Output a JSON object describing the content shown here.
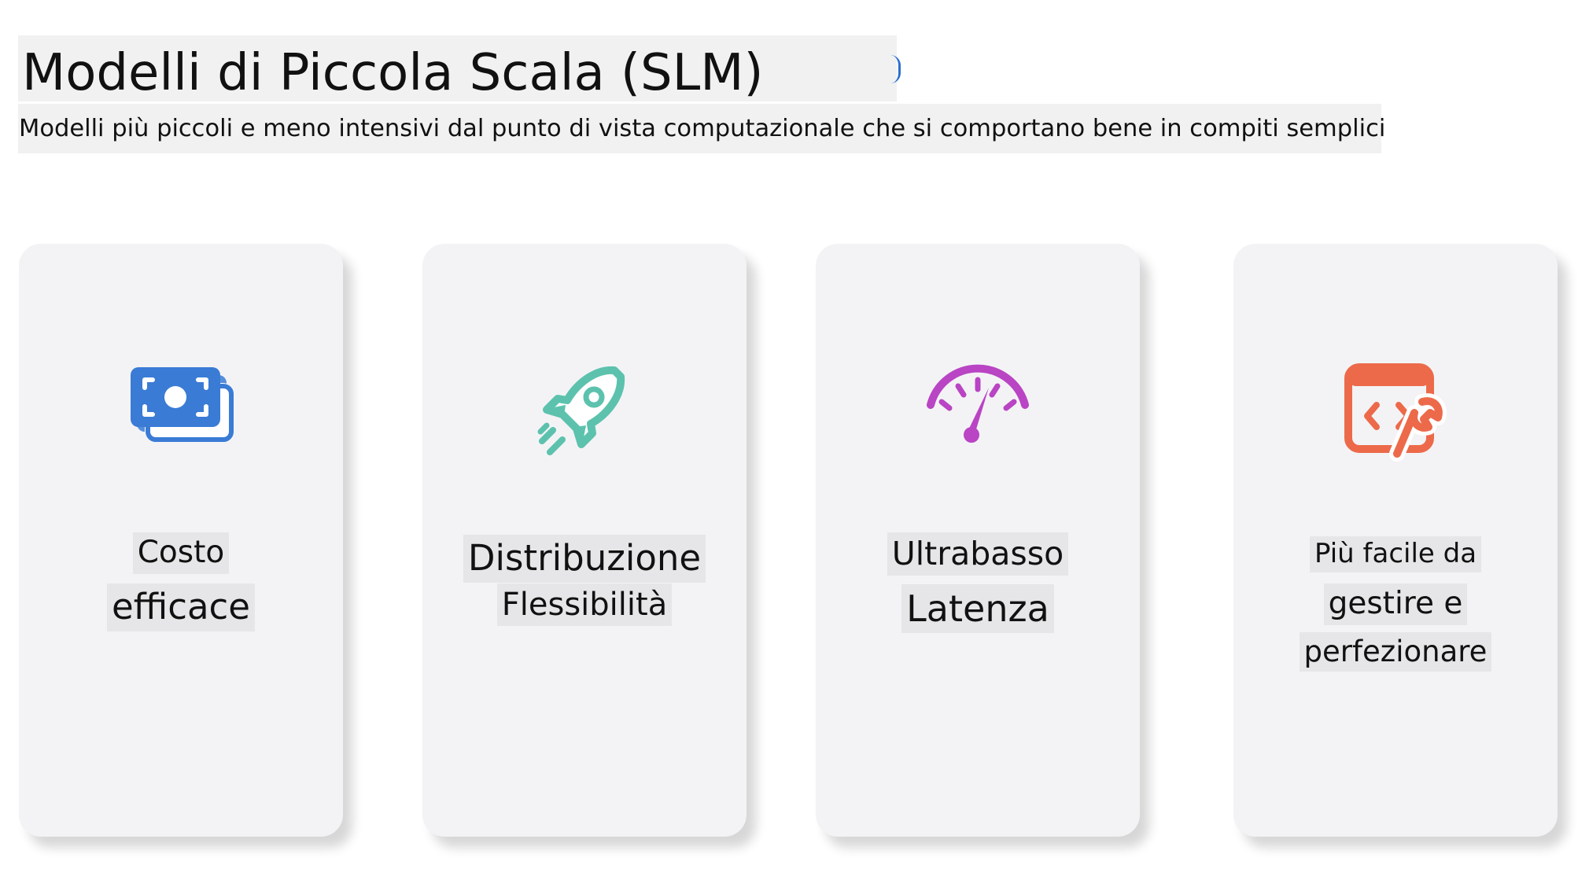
{
  "header": {
    "title": "Modelli di Piccola Scala (SLM)",
    "subtitle": "Modelli più piccoli e meno intensivi dal punto di vista computazionale che si comportano bene in compiti semplici"
  },
  "colors": {
    "money_icon": "#3a7bd5",
    "rocket_icon": "#5cc2ad",
    "gauge_icon": "#b944c4",
    "tools_icon": "#ec6a4a",
    "card_background": "#f3f3f5"
  },
  "cards": [
    {
      "icon": "money-icon",
      "lines": [
        "Costo",
        "efficace"
      ]
    },
    {
      "icon": "rocket-icon",
      "lines": [
        "Distribuzione",
        "Flessibilità"
      ]
    },
    {
      "icon": "speedometer-icon",
      "lines": [
        "Ultrabasso",
        "Latenza"
      ]
    },
    {
      "icon": "code-wrench-icon",
      "lines": [
        "Più facile da",
        "gestire e",
        "perfezionare"
      ]
    }
  ]
}
